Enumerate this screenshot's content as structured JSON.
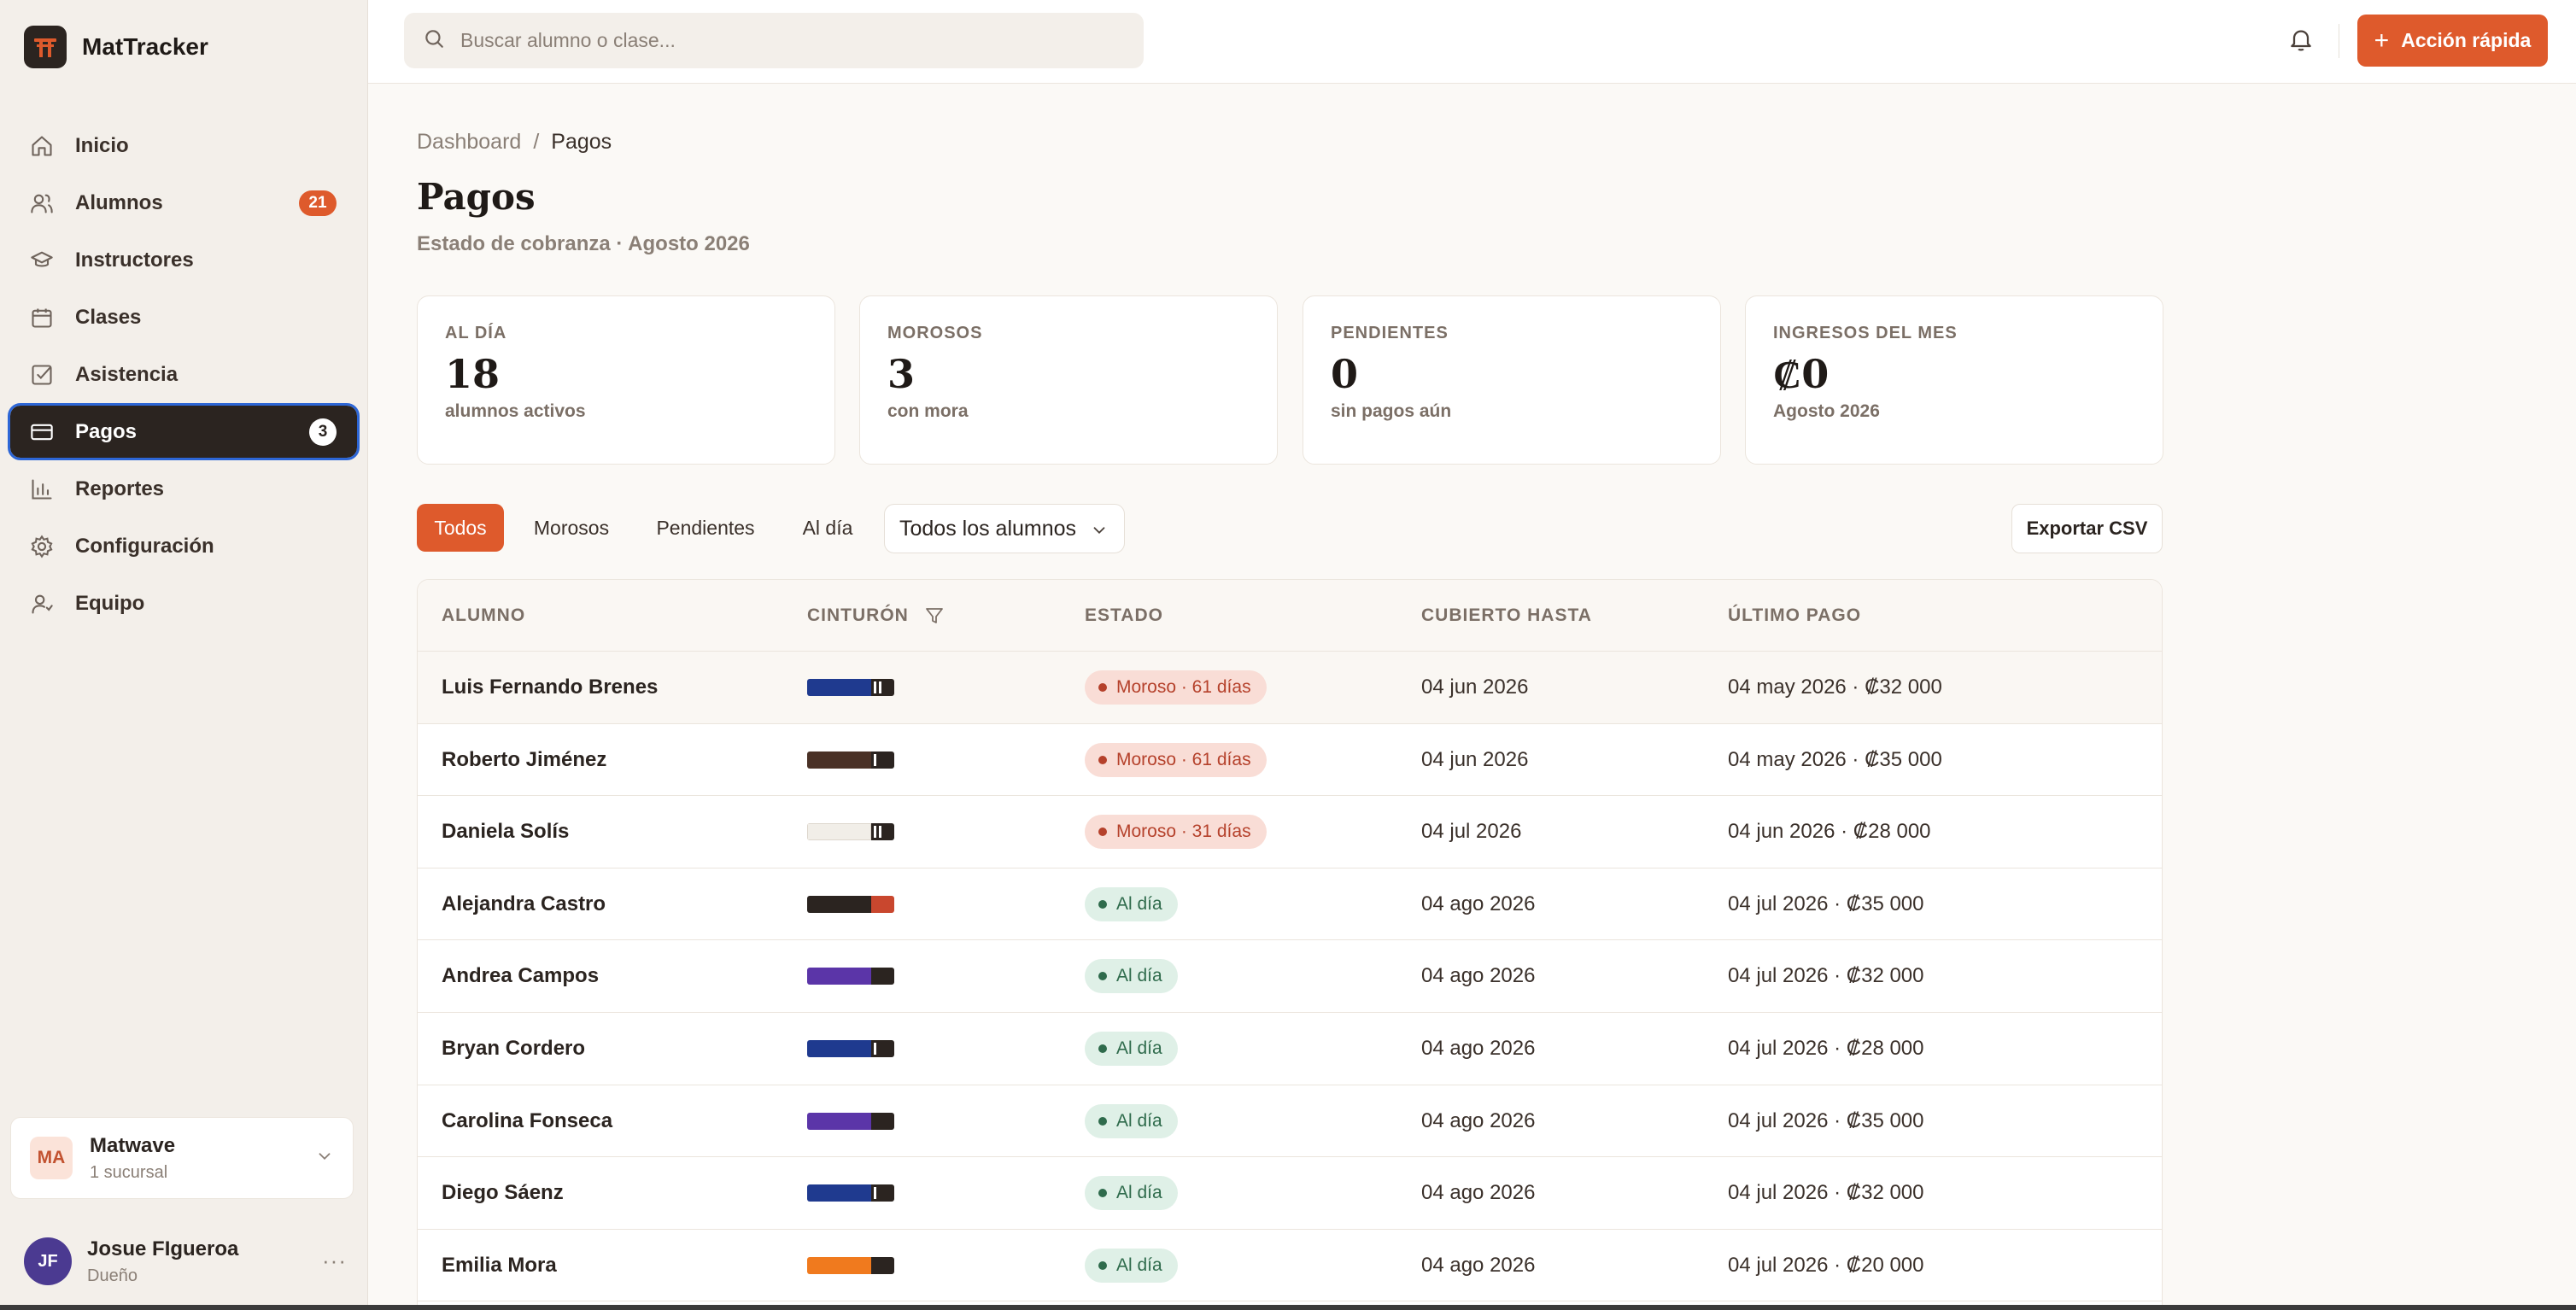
{
  "app": {
    "name": "MatTracker",
    "accent": "#de5a2c",
    "dark": "#2b2420"
  },
  "sidebar": {
    "items": [
      {
        "label": "Inicio",
        "icon": "home-icon"
      },
      {
        "label": "Alumnos",
        "icon": "users-icon",
        "badge": "21"
      },
      {
        "label": "Instructores",
        "icon": "graduation-cap-icon"
      },
      {
        "label": "Clases",
        "icon": "calendar-icon"
      },
      {
        "label": "Asistencia",
        "icon": "checkbox-icon"
      },
      {
        "label": "Pagos",
        "icon": "credit-card-icon",
        "badge": "3",
        "active": true
      },
      {
        "label": "Reportes",
        "icon": "bar-chart-icon"
      },
      {
        "label": "Configuración",
        "icon": "gear-icon"
      },
      {
        "label": "Equipo",
        "icon": "user-team-icon"
      }
    ],
    "branch": {
      "initials": "MA",
      "name": "Matwave",
      "sub": "1 sucursal"
    },
    "user": {
      "initials": "JF",
      "name": "Josue FIgueroa",
      "role": "Dueño",
      "more": "···"
    }
  },
  "topbar": {
    "search_placeholder": "Buscar alumno o clase...",
    "quick_action_label": "Acción rápida"
  },
  "breadcrumb": {
    "parent": "Dashboard",
    "separator": "/",
    "current": "Pagos"
  },
  "page": {
    "title": "Pagos",
    "subtitle": "Estado de cobranza · Agosto 2026"
  },
  "stats": [
    {
      "label": "AL DÍA",
      "value": "18",
      "sub": "alumnos activos"
    },
    {
      "label": "MOROSOS",
      "value": "3",
      "sub": "con mora"
    },
    {
      "label": "PENDIENTES",
      "value": "0",
      "sub": "sin pagos aún"
    },
    {
      "label": "INGRESOS DEL MES",
      "value": "₡0",
      "sub": "Agosto 2026"
    }
  ],
  "filters": {
    "tabs": [
      "Todos",
      "Morosos",
      "Pendientes",
      "Al día"
    ],
    "active_tab": "Todos",
    "select_value": "Todos los alumnos",
    "export_label": "Exportar CSV"
  },
  "table": {
    "columns": [
      "ALUMNO",
      "CINTURÓN",
      "ESTADO",
      "CUBIERTO HASTA",
      "ÚLTIMO PAGO"
    ],
    "rows": [
      {
        "name": "Luis Fernando Brenes",
        "belt": {
          "color": "#1f3a8f",
          "tip": "#2b2420",
          "stripes": 2
        },
        "status": "Moroso · 61 días",
        "kind": "late",
        "covered": "04 jun 2026",
        "last": "04 may 2026 · ₡32 000"
      },
      {
        "name": "Roberto Jiménez",
        "belt": {
          "color": "#4a3126",
          "tip": "#2b2420",
          "stripes": 1
        },
        "status": "Moroso · 61 días",
        "kind": "late",
        "covered": "04 jun 2026",
        "last": "04 may 2026 · ₡35 000"
      },
      {
        "name": "Daniela Solís",
        "belt": {
          "color": "#f1eee8",
          "tip": "#2b2420",
          "stripes": 2
        },
        "status": "Moroso · 31 días",
        "kind": "late",
        "covered": "04 jul 2026",
        "last": "04 jun 2026 · ₡28 000"
      },
      {
        "name": "Alejandra Castro",
        "belt": {
          "color": "#2b2420",
          "tip": "#c9472e",
          "stripes": 0
        },
        "status": "Al día",
        "kind": "ok",
        "covered": "04 ago 2026",
        "last": "04 jul 2026 · ₡35 000"
      },
      {
        "name": "Andrea Campos",
        "belt": {
          "color": "#5b35a8",
          "tip": "#2b2420",
          "stripes": 0
        },
        "status": "Al día",
        "kind": "ok",
        "covered": "04 ago 2026",
        "last": "04 jul 2026 · ₡32 000"
      },
      {
        "name": "Bryan Cordero",
        "belt": {
          "color": "#1f3a8f",
          "tip": "#2b2420",
          "stripes": 1
        },
        "status": "Al día",
        "kind": "ok",
        "covered": "04 ago 2026",
        "last": "04 jul 2026 · ₡28 000"
      },
      {
        "name": "Carolina Fonseca",
        "belt": {
          "color": "#5b35a8",
          "tip": "#2b2420",
          "stripes": 0
        },
        "status": "Al día",
        "kind": "ok",
        "covered": "04 ago 2026",
        "last": "04 jul 2026 · ₡35 000"
      },
      {
        "name": "Diego Sáenz",
        "belt": {
          "color": "#1f3a8f",
          "tip": "#2b2420",
          "stripes": 1
        },
        "status": "Al día",
        "kind": "ok",
        "covered": "04 ago 2026",
        "last": "04 jul 2026 · ₡32 000"
      },
      {
        "name": "Emilia Mora",
        "belt": {
          "color": "#f07a1e",
          "tip": "#2b2420",
          "stripes": 0
        },
        "status": "Al día",
        "kind": "ok",
        "covered": "04 ago 2026",
        "last": "04 jul 2026 · ₡20 000"
      }
    ]
  }
}
